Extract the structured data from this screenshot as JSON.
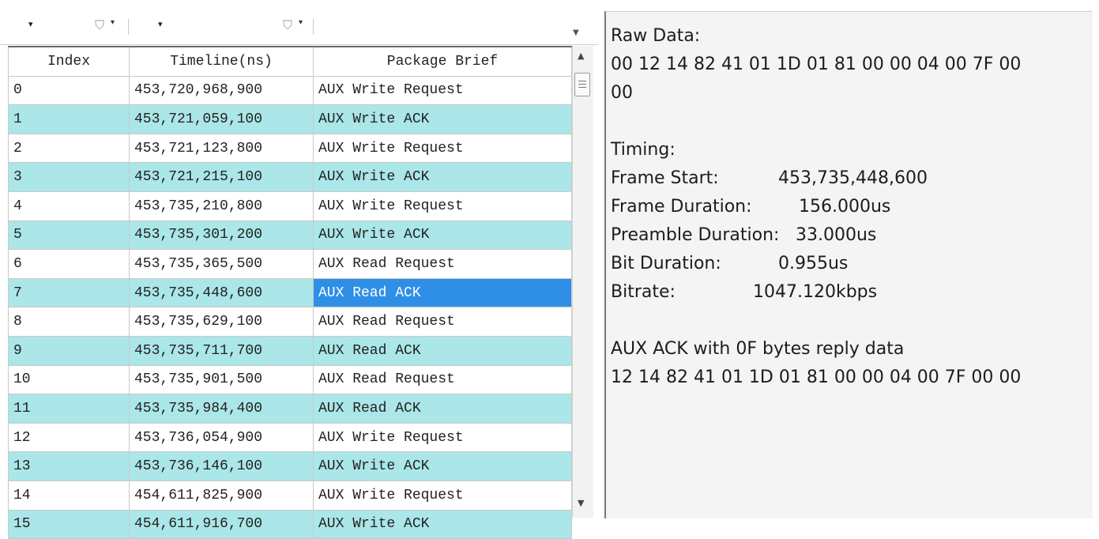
{
  "filters": [
    {
      "dropdown_arrow": "▾",
      "filter_icon": "funnel-icon",
      "caret": "▾"
    },
    {
      "dropdown_arrow": "▾",
      "filter_icon": "funnel-icon",
      "caret": "▾"
    }
  ],
  "table": {
    "columns": [
      "Index",
      "Timeline(ns)",
      "Package Brief"
    ],
    "rows": [
      {
        "index": "0",
        "timeline": "453,720,968,900",
        "brief": "AUX Write Request"
      },
      {
        "index": "1",
        "timeline": "453,721,059,100",
        "brief": "AUX Write ACK"
      },
      {
        "index": "2",
        "timeline": "453,721,123,800",
        "brief": "AUX Write Request"
      },
      {
        "index": "3",
        "timeline": "453,721,215,100",
        "brief": "AUX Write ACK"
      },
      {
        "index": "4",
        "timeline": "453,735,210,800",
        "brief": "AUX Write Request"
      },
      {
        "index": "5",
        "timeline": "453,735,301,200",
        "brief": "AUX Write ACK"
      },
      {
        "index": "6",
        "timeline": "453,735,365,500",
        "brief": "AUX Read Request"
      },
      {
        "index": "7",
        "timeline": "453,735,448,600",
        "brief": "AUX Read ACK"
      },
      {
        "index": "8",
        "timeline": "453,735,629,100",
        "brief": "AUX Read Request"
      },
      {
        "index": "9",
        "timeline": "453,735,711,700",
        "brief": "AUX Read ACK"
      },
      {
        "index": "10",
        "timeline": "453,735,901,500",
        "brief": "AUX Read Request"
      },
      {
        "index": "11",
        "timeline": "453,735,984,400",
        "brief": "AUX Read ACK"
      },
      {
        "index": "12",
        "timeline": "453,736,054,900",
        "brief": "AUX Write Request"
      },
      {
        "index": "13",
        "timeline": "453,736,146,100",
        "brief": "AUX Write ACK"
      },
      {
        "index": "14",
        "timeline": "454,611,825,900",
        "brief": "AUX Write Request"
      },
      {
        "index": "15",
        "timeline": "454,611,916,700",
        "brief": "AUX Write ACK"
      }
    ],
    "selected_index": "7"
  },
  "detail": {
    "raw_data_label": "Raw Data:",
    "raw_data_line1": "00 12 14 82 41 01 1D 01 81 00 00 04 00 7F 00",
    "raw_data_line2": "00",
    "timing_label": "Timing:",
    "frame_start_label": "Frame Start:",
    "frame_start_value": "453,735,448,600",
    "frame_duration_label": "Frame Duration:",
    "frame_duration_value": "156.000us",
    "preamble_label": "Preamble Duration:",
    "preamble_value": "33.000us",
    "bit_duration_label": "Bit Duration:",
    "bit_duration_value": "0.955us",
    "bitrate_label": "Bitrate:",
    "bitrate_value": "1047.120kbps",
    "summary": "AUX ACK with 0F bytes reply data",
    "reply_bytes": "12 14 82 41 01 1D 01 81 00 00 04 00 7F 00 00"
  },
  "colors": {
    "row_alt": "#abe6e8",
    "selected": "#2f8fe6"
  }
}
